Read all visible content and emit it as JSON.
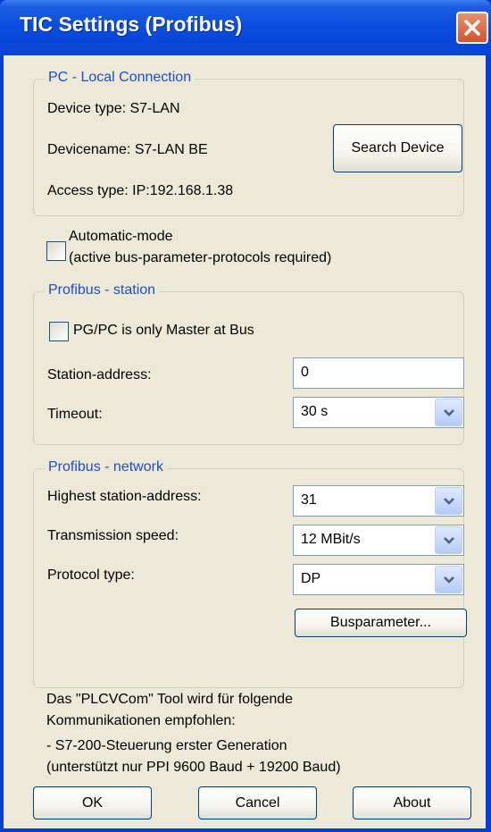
{
  "window": {
    "title": "TIC Settings (Profibus)"
  },
  "pc_local": {
    "legend": "PC - Local Connection",
    "device_type": "Device type:  S7-LAN",
    "device_name": "Devicename: S7-LAN BE",
    "access_type": "Access type:  IP:192.168.1.38",
    "search_button": "Search Device"
  },
  "automatic_mode": {
    "line1": "Automatic-mode",
    "line2": "(active bus-parameter-protocols required)"
  },
  "station": {
    "legend": "Profibus - station",
    "only_master": "PG/PC is only Master at Bus",
    "address_label": "Station-address:",
    "address_value": "0",
    "timeout_label": "Timeout:",
    "timeout_value": "30 s"
  },
  "network": {
    "legend": "Profibus - network",
    "highest_label": "Highest station-address:",
    "highest_value": "31",
    "speed_label": "Transmission speed:",
    "speed_value": "12 MBit/s",
    "protocol_label": "Protocol type:",
    "protocol_value": "DP",
    "busparam_button": "Busparameter..."
  },
  "info": {
    "line1": "Das \"PLCVCom\" Tool wird für folgende",
    "line2": "Kommunikationen empfohlen:",
    "line3": " - S7-200-Steuerung erster Generation",
    "line4": " (unterstützt nur PPI 9600 Baud + 19200 Baud)"
  },
  "buttons": {
    "ok": "OK",
    "cancel": "Cancel",
    "about": "About"
  },
  "colors": {
    "titlebar": "#0a4ee0",
    "legend_text": "#1f4bc4",
    "dialog_bg": "#ece9d8",
    "close": "#d4532d"
  }
}
